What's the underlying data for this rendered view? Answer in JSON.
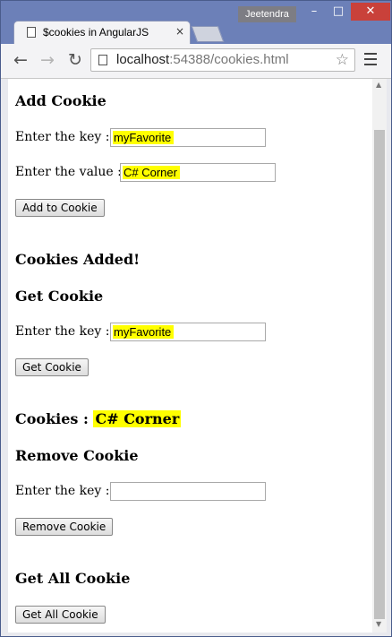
{
  "window": {
    "user": "Jeetendra",
    "controls": {
      "min": "–",
      "max": "□",
      "close": "✕"
    }
  },
  "tab": {
    "title": "$cookies in AngularJS",
    "close": "×"
  },
  "toolbar": {
    "url_host": "localhost",
    "url_rest": ":54388/cookies.html",
    "back": "←",
    "forward": "→",
    "reload": "↻",
    "star": "☆"
  },
  "page": {
    "add": {
      "heading": "Add Cookie",
      "key_label": "Enter the key :",
      "key_value": "myFavorite",
      "value_label": "Enter the value :",
      "value_value": "C# Corner",
      "button": "Add to Cookie"
    },
    "added_message": "Cookies Added!",
    "get": {
      "heading": "Get Cookie",
      "key_label": "Enter the key :",
      "key_value": "myFavorite",
      "button": "Get Cookie"
    },
    "result": {
      "label": "Cookies :",
      "value": "C# Corner"
    },
    "remove": {
      "heading": "Remove Cookie",
      "key_label": "Enter the key :",
      "key_value": "",
      "button": "Remove Cookie"
    },
    "get_all": {
      "heading": "Get All Cookie",
      "button": "Get All Cookie"
    }
  },
  "colors": {
    "highlight": "#ffff00",
    "titlebar": "#6c80b8",
    "close_button": "#c9413a"
  }
}
